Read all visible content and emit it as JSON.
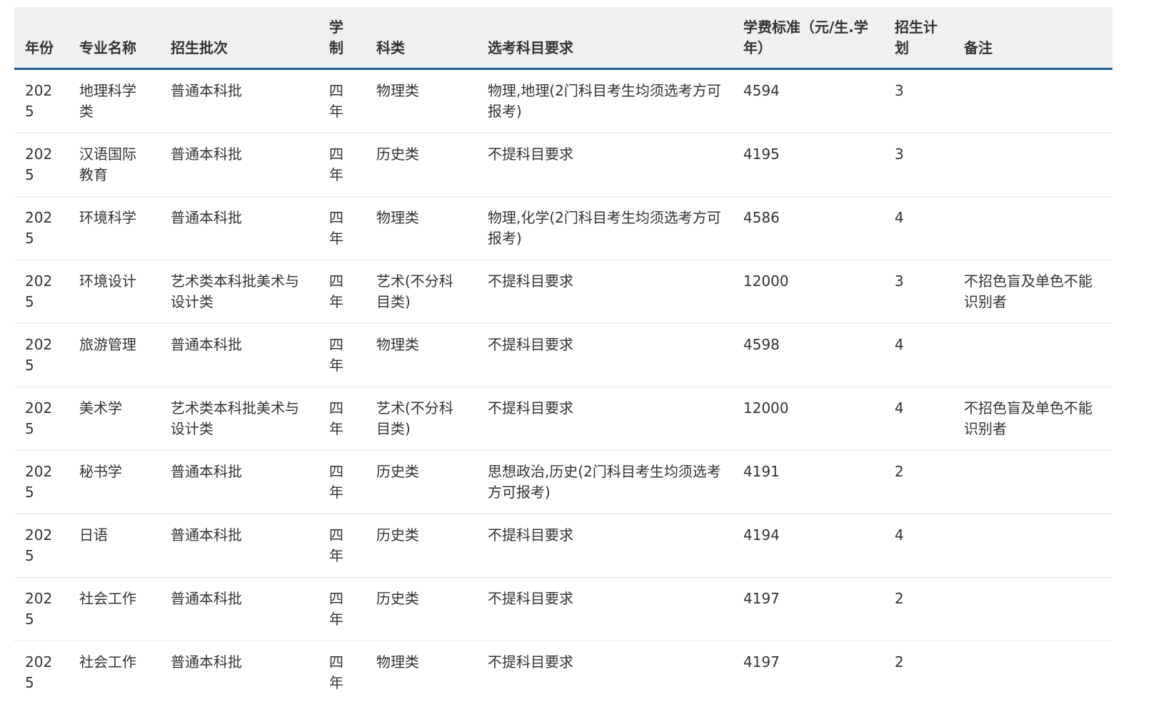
{
  "table": {
    "headers": [
      "年份",
      "专业名称",
      "招生批次",
      "学制",
      "科类",
      "选考科目要求",
      "学费标准（元/生.学年）",
      "招生计划",
      "备注"
    ],
    "rows": [
      [
        "2025",
        "地理科学类",
        "普通本科批",
        "四年",
        "物理类",
        "物理,地理(2门科目考生均须选考方可报考)",
        "4594",
        "3",
        ""
      ],
      [
        "2025",
        "汉语国际教育",
        "普通本科批",
        "四年",
        "历史类",
        "不提科目要求",
        "4195",
        "3",
        ""
      ],
      [
        "2025",
        "环境科学",
        "普通本科批",
        "四年",
        "物理类",
        "物理,化学(2门科目考生均须选考方可报考)",
        "4586",
        "4",
        ""
      ],
      [
        "2025",
        "环境设计",
        "艺术类本科批美术与设计类",
        "四年",
        "艺术(不分科目类)",
        "不提科目要求",
        "12000",
        "3",
        "不招色盲及单色不能识别者"
      ],
      [
        "2025",
        "旅游管理",
        "普通本科批",
        "四年",
        "物理类",
        "不提科目要求",
        "4598",
        "4",
        ""
      ],
      [
        "2025",
        "美术学",
        "艺术类本科批美术与设计类",
        "四年",
        "艺术(不分科目类)",
        "不提科目要求",
        "12000",
        "4",
        "不招色盲及单色不能识别者"
      ],
      [
        "2025",
        "秘书学",
        "普通本科批",
        "四年",
        "历史类",
        "思想政治,历史(2门科目考生均须选考方可报考)",
        "4191",
        "2",
        ""
      ],
      [
        "2025",
        "日语",
        "普通本科批",
        "四年",
        "历史类",
        "不提科目要求",
        "4194",
        "4",
        ""
      ],
      [
        "2025",
        "社会工作",
        "普通本科批",
        "四年",
        "历史类",
        "不提科目要求",
        "4197",
        "2",
        ""
      ],
      [
        "2025",
        "社会工作",
        "普通本科批",
        "四年",
        "物理类",
        "不提科目要求",
        "4197",
        "2",
        ""
      ]
    ]
  }
}
